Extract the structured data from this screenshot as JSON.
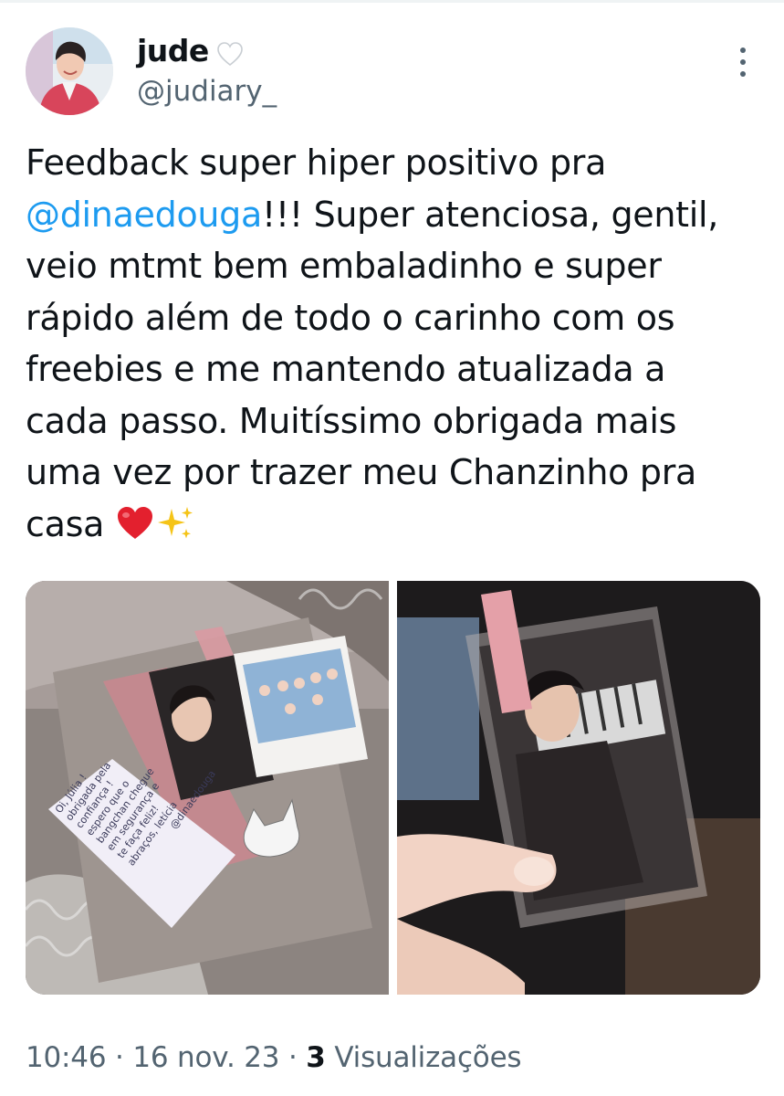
{
  "user": {
    "display_name": "jude",
    "handle": "@judiary_"
  },
  "tweet": {
    "lines": [
      {
        "pre": "Feedback super hiper positivo pra",
        "mention": "",
        "post": ""
      },
      {
        "pre": "",
        "mention": "@dinaedouga",
        "post": "!!! Super atenciosa, gentil,"
      },
      {
        "pre": "veio mtmt bem embaladinho e super",
        "mention": "",
        "post": ""
      },
      {
        "pre": "rápido além de todo o carinho com os",
        "mention": "",
        "post": ""
      },
      {
        "pre": "freebies e me mantendo atualizada a",
        "mention": "",
        "post": ""
      },
      {
        "pre": "cada passo. Muitíssimo obrigada mais",
        "mention": "",
        "post": ""
      },
      {
        "pre": "uma vez por trazer meu Chanzinho pra",
        "mention": "",
        "post": ""
      },
      {
        "pre": "casa ",
        "mention": "",
        "post": ""
      }
    ],
    "emojis": [
      "red-heart",
      "sparkles"
    ]
  },
  "media": {
    "note_lines": [
      "Oi, Júlia !",
      "obrigada pela",
      "confiança !",
      "espero que o",
      "bangchan chegue",
      "em segurança e",
      "te faça feliz!",
      "abraços, letícia",
      "@dinaedouga"
    ]
  },
  "meta": {
    "time": "10:46",
    "sep1": " · ",
    "date": "16 nov. 23",
    "sep2": " · ",
    "views_count": "3",
    "views_label": " Visualizações"
  },
  "colors": {
    "accent": "#1d9bf0",
    "secondary_text": "#536471",
    "primary_text": "#0f1419"
  },
  "icons": {
    "verified_heart": "white-heart-icon",
    "more": "more-options-icon"
  }
}
